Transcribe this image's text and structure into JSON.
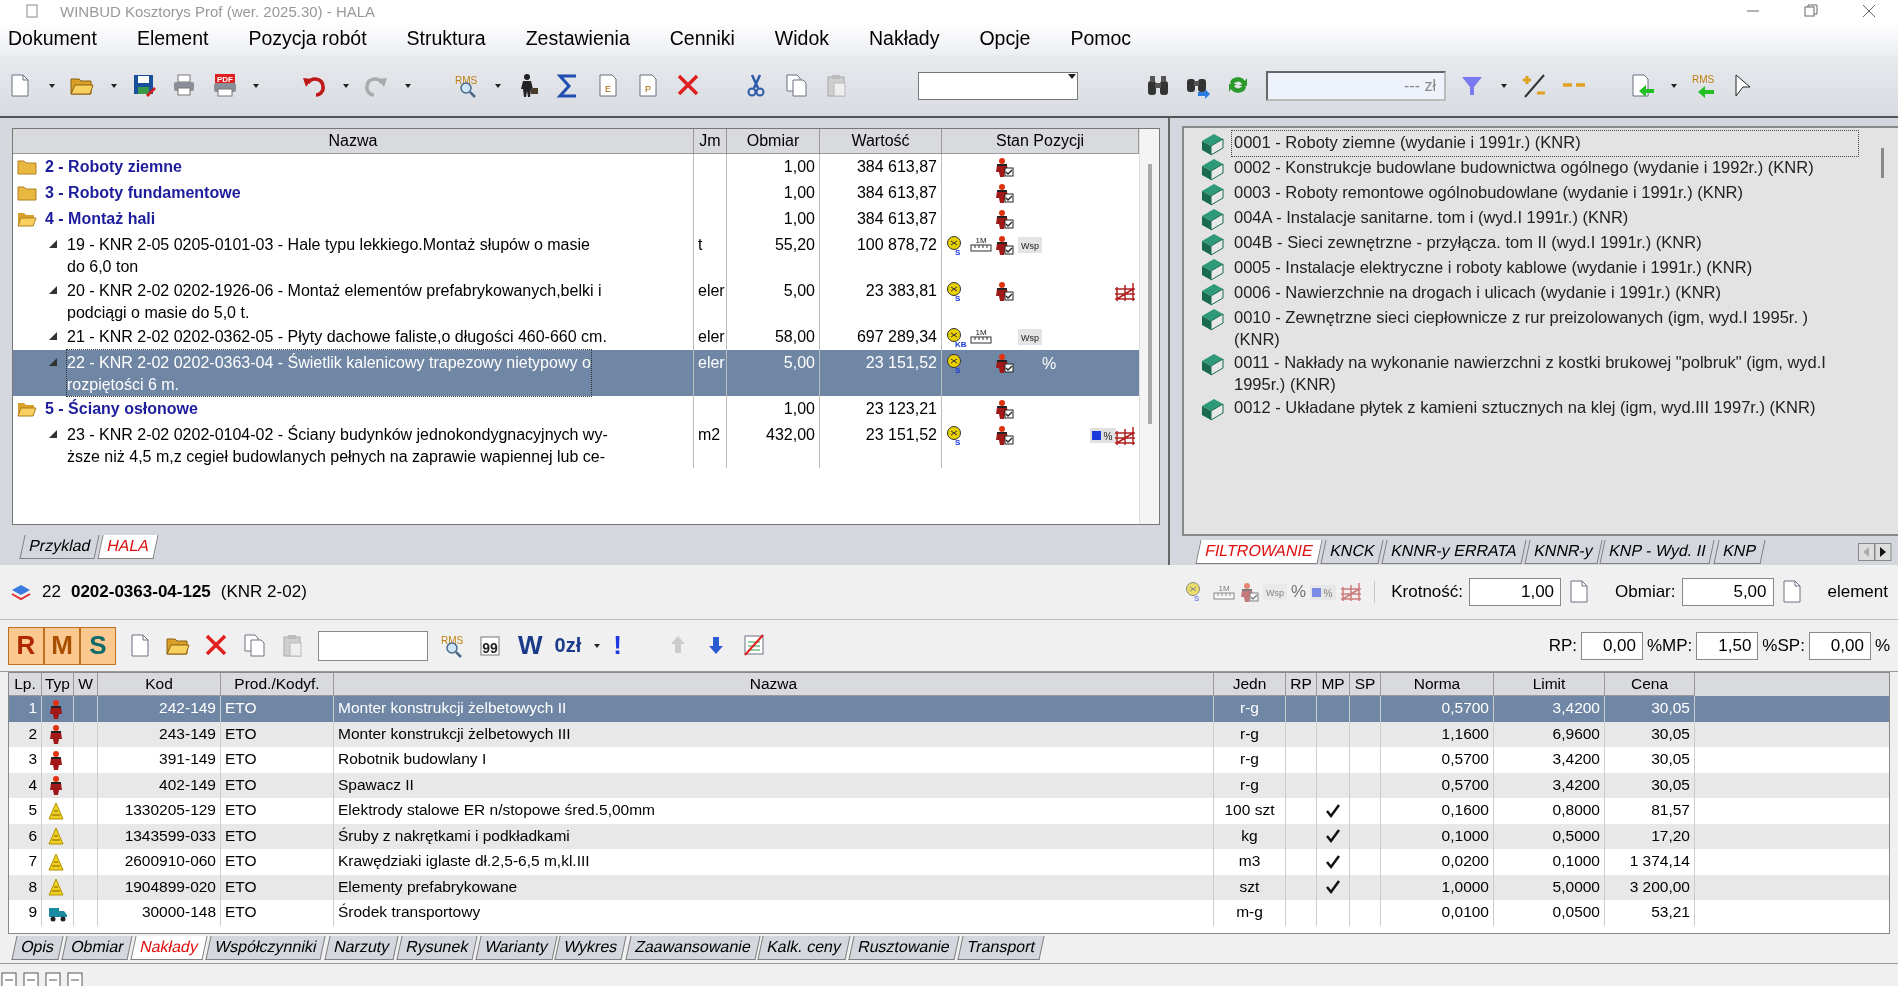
{
  "window": {
    "title": "WINBUD Kosztorys Prof (wer. 2025.30) - HALA"
  },
  "menu": [
    "Dokument",
    "Element",
    "Pozycja robót",
    "Struktura",
    "Zestawienia",
    "Cenniki",
    "Widok",
    "Nakłady",
    "Opcje",
    "Pomoc"
  ],
  "toolbar": {
    "pdf_label": "PDF",
    "rms_label": "RMS",
    "e_label": "E",
    "p_label": "P",
    "price_field": {
      "value": "--- zł"
    },
    "rms_back_label": "RMS"
  },
  "estimate_tree": {
    "columns": [
      "Nazwa",
      "Jm",
      "Obmiar",
      "Wartość",
      "Stan Pozycji"
    ],
    "rows": [
      {
        "name": "2 - Roboty ziemne",
        "expanded": false,
        "selected": false,
        "obmiar": "1,00",
        "wartosc": "384 613,87",
        "status": [
          {
            "kind": "worker"
          }
        ]
      },
      {
        "name": "3 - Roboty fundamentowe",
        "expanded": false,
        "selected": false,
        "obmiar": "1,00",
        "wartosc": "384 613,87",
        "status": [
          {
            "kind": "worker"
          }
        ]
      },
      {
        "name": "4 - Montaż hali",
        "expanded": true,
        "selected": false,
        "obmiar": "1,00",
        "wartosc": "384 613,87",
        "status": [
          {
            "kind": "worker"
          }
        ],
        "children": [
          {
            "lines": [
              "19 - KNR 2-05 0205-0101-03 - Hale typu lekkiego.Montaż słupów o masie",
              "do 6,0 ton"
            ],
            "jm": "t",
            "obmiar": "55,20",
            "wartosc": "100 878,72",
            "selected": false,
            "status": [
              {
                "kind": "coin",
                "label": "S"
              },
              {
                "kind": "meter",
                "label": "1M"
              },
              {
                "kind": "worker"
              },
              {
                "kind": "wsp",
                "label": "Wsp"
              }
            ]
          },
          {
            "lines": [
              "20 - KNR 2-02 0202-1926-06 - Montaż elementów prefabrykowanych,belki i",
              "podciągi o masie do 5,0 t."
            ],
            "jm": "eler",
            "obmiar": "5,00",
            "wartosc": "23 383,81",
            "selected": false,
            "status": [
              {
                "kind": "coin",
                "label": "S"
              },
              {
                "kind": "worker"
              },
              {
                "kind": "scaffold"
              }
            ]
          },
          {
            "lines": [
              "21 - KNR 2-02 0202-0362-05 - Płyty dachowe faliste,o długości 460-660 cm."
            ],
            "jm": "eler",
            "obmiar": "58,00",
            "wartosc": "697 289,34",
            "selected": false,
            "status": [
              {
                "kind": "coin",
                "label": "KB"
              },
              {
                "kind": "meter",
                "label": "1M"
              },
              {
                "kind": "wsp",
                "label": "Wsp"
              }
            ]
          },
          {
            "lines": [
              "22 - KNR 2-02 0202-0363-04 - Świetlik kalenicowy trapezowy nietypowy o",
              "rozpiętości 6 m."
            ],
            "jm": "eler",
            "obmiar": "5,00",
            "wartosc": "23 151,52",
            "selected": true,
            "status": [
              {
                "kind": "coin",
                "label": "S"
              },
              {
                "kind": "worker"
              },
              {
                "kind": "percent",
                "label": "%"
              }
            ]
          }
        ]
      },
      {
        "name": "5 - Ściany osłonowe",
        "expanded": true,
        "selected": false,
        "obmiar": "1,00",
        "wartosc": "23 123,21",
        "status": [
          {
            "kind": "worker"
          }
        ],
        "children": [
          {
            "lines": [
              "23 - KNR 2-02 0202-0104-02 - Ściany budynków jednokondygnacyjnych wy-",
              "ższe niż 4,5 m,z cegieł budowlanych pełnych na zaprawie wapiennej lub ce-"
            ],
            "jm": "m2",
            "obmiar": "432,00",
            "wartosc": "23 151,52",
            "selected": false,
            "status": [
              {
                "kind": "coin",
                "label": "S"
              },
              {
                "kind": "worker"
              },
              {
                "kind": "bar_percent",
                "label": "%"
              },
              {
                "kind": "scaffold"
              }
            ]
          }
        ]
      }
    ]
  },
  "document_tabs": [
    {
      "label": "Przyklad",
      "selected": false
    },
    {
      "label": "HALA",
      "selected": true
    }
  ],
  "catalog": {
    "items": [
      {
        "label": "0001 - Roboty ziemne (wydanie i 1991r.) (KNR)",
        "selected": true
      },
      {
        "label": "0002 - Konstrukcje budowlane budownictwa ogólnego (wydanie i 1992r.) (KNR)",
        "selected": false
      },
      {
        "label": "0003 - Roboty remontowe ogólnobudowlane (wydanie i 1991r.) (KNR)",
        "selected": false
      },
      {
        "label": "004A - Instalacje sanitarne. tom i (wyd.I 1991r.) (KNR)",
        "selected": false
      },
      {
        "label": "004B - Sieci zewnętrzne - przyłącza. tom II (wyd.I 1991r.) (KNR)",
        "selected": false
      },
      {
        "label": "0005 - Instalacje elektryczne i roboty kablowe (wydanie i 1991r.) (KNR)",
        "selected": false
      },
      {
        "label": "0006 - Nawierzchnie na drogach i ulicach (wydanie i 1991r.) (KNR)",
        "selected": false
      },
      {
        "label": "0010 - Zewnętrzne sieci ciepłownicze z rur preizolowanych (igm, wyd.I 1995r. ) (KNR)",
        "selected": false
      },
      {
        "label": "0011 - Nakłady na wykonanie nawierzchni z kostki brukowej \"polbruk\" (igm, wyd.I 1995r.) (KNR)",
        "selected": false
      },
      {
        "label": "0012 - Układane płytek z kamieni sztucznych na klej (igm, wyd.III 1997r.) (KNR)",
        "selected": false
      }
    ],
    "tabs": [
      {
        "label": "FILTROWANIE",
        "selected": true
      },
      {
        "label": "KNCK",
        "selected": false
      },
      {
        "label": "KNNR-y ERRATA",
        "selected": false
      },
      {
        "label": "KNNR-y",
        "selected": false
      },
      {
        "label": "KNP - Wyd. II",
        "selected": false
      },
      {
        "label": "KNP",
        "selected": false
      }
    ]
  },
  "position_info": {
    "number": "22",
    "code": "0202-0363-04-125",
    "catalog": "(KNR 2-02)",
    "indicators": [
      {
        "kind": "coin",
        "label": "S"
      },
      {
        "kind": "meter",
        "label": "1M"
      },
      {
        "kind": "worker"
      },
      {
        "kind": "wsp",
        "label": "Wsp"
      },
      {
        "kind": "percent",
        "label": "%"
      },
      {
        "kind": "bar_percent",
        "label": "%"
      },
      {
        "kind": "scaffold"
      }
    ],
    "multiplier_label": "Krotność:",
    "multiplier": "1,00",
    "quantity_label": "Obmiar:",
    "quantity": "5,00",
    "unit": "element"
  },
  "resources_toolbar": {
    "filters": [
      {
        "label": "R",
        "on": true
      },
      {
        "label": "M",
        "on": true
      },
      {
        "label": "S",
        "on": true
      }
    ],
    "rms_label": "RMS",
    "quote_label": "99",
    "w_label": "W",
    "zero_label": "0zł",
    "mark_label": "!",
    "rp_label": "RP:",
    "rp": "0,00",
    "mp_label": "%MP:",
    "mp": "1,50",
    "sp_label": "%SP:",
    "sp": "0,00",
    "percent_label": "%"
  },
  "resources": {
    "columns": [
      "Lp.",
      "Typ",
      "W",
      "Kod",
      "Prod./Kodyf.",
      "Nazwa",
      "Jedn",
      "RP",
      "MP",
      "SP",
      "Norma",
      "Limit",
      "Cena"
    ],
    "rows": [
      {
        "lp": "1",
        "kind": "labor",
        "kod": "242-149",
        "prod": "ETO",
        "nazwa": "Monter konstrukcji żelbetowych II",
        "jedn": "r-g",
        "mp": false,
        "norma": "0,5700",
        "limit": "3,4200",
        "cena": "30,05",
        "selected": true
      },
      {
        "lp": "2",
        "kind": "labor",
        "kod": "243-149",
        "prod": "ETO",
        "nazwa": "Monter konstrukcji żelbetowych III",
        "jedn": "r-g",
        "mp": false,
        "norma": "1,1600",
        "limit": "6,9600",
        "cena": "30,05",
        "selected": false
      },
      {
        "lp": "3",
        "kind": "labor",
        "kod": "391-149",
        "prod": "ETO",
        "nazwa": "Robotnik budowlany I",
        "jedn": "r-g",
        "mp": false,
        "norma": "0,5700",
        "limit": "3,4200",
        "cena": "30,05",
        "selected": false
      },
      {
        "lp": "4",
        "kind": "labor",
        "kod": "402-149",
        "prod": "ETO",
        "nazwa": "Spawacz II",
        "jedn": "r-g",
        "mp": false,
        "norma": "0,5700",
        "limit": "3,4200",
        "cena": "30,05",
        "selected": false
      },
      {
        "lp": "5",
        "kind": "material",
        "kod": "1330205-129",
        "prod": "ETO",
        "nazwa": "Elektrody stalowe ER n/stopowe śred.5,00mm",
        "jedn": "100 szt",
        "mp": true,
        "norma": "0,1600",
        "limit": "0,8000",
        "cena": "81,57",
        "selected": false
      },
      {
        "lp": "6",
        "kind": "material",
        "kod": "1343599-033",
        "prod": "ETO",
        "nazwa": "Śruby z nakrętkami i podkładkami",
        "jedn": "kg",
        "mp": true,
        "norma": "0,1000",
        "limit": "0,5000",
        "cena": "17,20",
        "selected": false
      },
      {
        "lp": "7",
        "kind": "material",
        "kod": "2600910-060",
        "prod": "ETO",
        "nazwa": "Krawędziaki iglaste dł.2,5-6,5 m,kl.III",
        "jedn": "m3",
        "mp": true,
        "norma": "0,0200",
        "limit": "0,1000",
        "cena": "1 374,14",
        "selected": false
      },
      {
        "lp": "8",
        "kind": "material",
        "kod": "1904899-020",
        "prod": "ETO",
        "nazwa": "Elementy prefabrykowane",
        "jedn": "szt",
        "mp": true,
        "norma": "1,0000",
        "limit": "5,0000",
        "cena": "3 200,00",
        "selected": false
      },
      {
        "lp": "9",
        "kind": "equipment",
        "kod": "30000-148",
        "prod": "ETO",
        "nazwa": "Środek transportowy",
        "jedn": "m-g",
        "mp": false,
        "norma": "0,0100",
        "limit": "0,0500",
        "cena": "53,21",
        "selected": false
      }
    ]
  },
  "detail_tabs": [
    {
      "label": "Opis",
      "selected": false
    },
    {
      "label": "Obmiar",
      "selected": false
    },
    {
      "label": "Nakłady",
      "selected": true
    },
    {
      "label": "Współczynniki",
      "selected": false
    },
    {
      "label": "Narzuty",
      "selected": false
    },
    {
      "label": "Rysunek",
      "selected": false
    },
    {
      "label": "Warianty",
      "selected": false
    },
    {
      "label": "Wykres",
      "selected": false
    },
    {
      "label": "Zaawansowanie",
      "selected": false
    },
    {
      "label": "Kalk. ceny",
      "selected": false
    },
    {
      "label": "Rusztowanie",
      "selected": false
    },
    {
      "label": "Transport",
      "selected": false
    }
  ]
}
